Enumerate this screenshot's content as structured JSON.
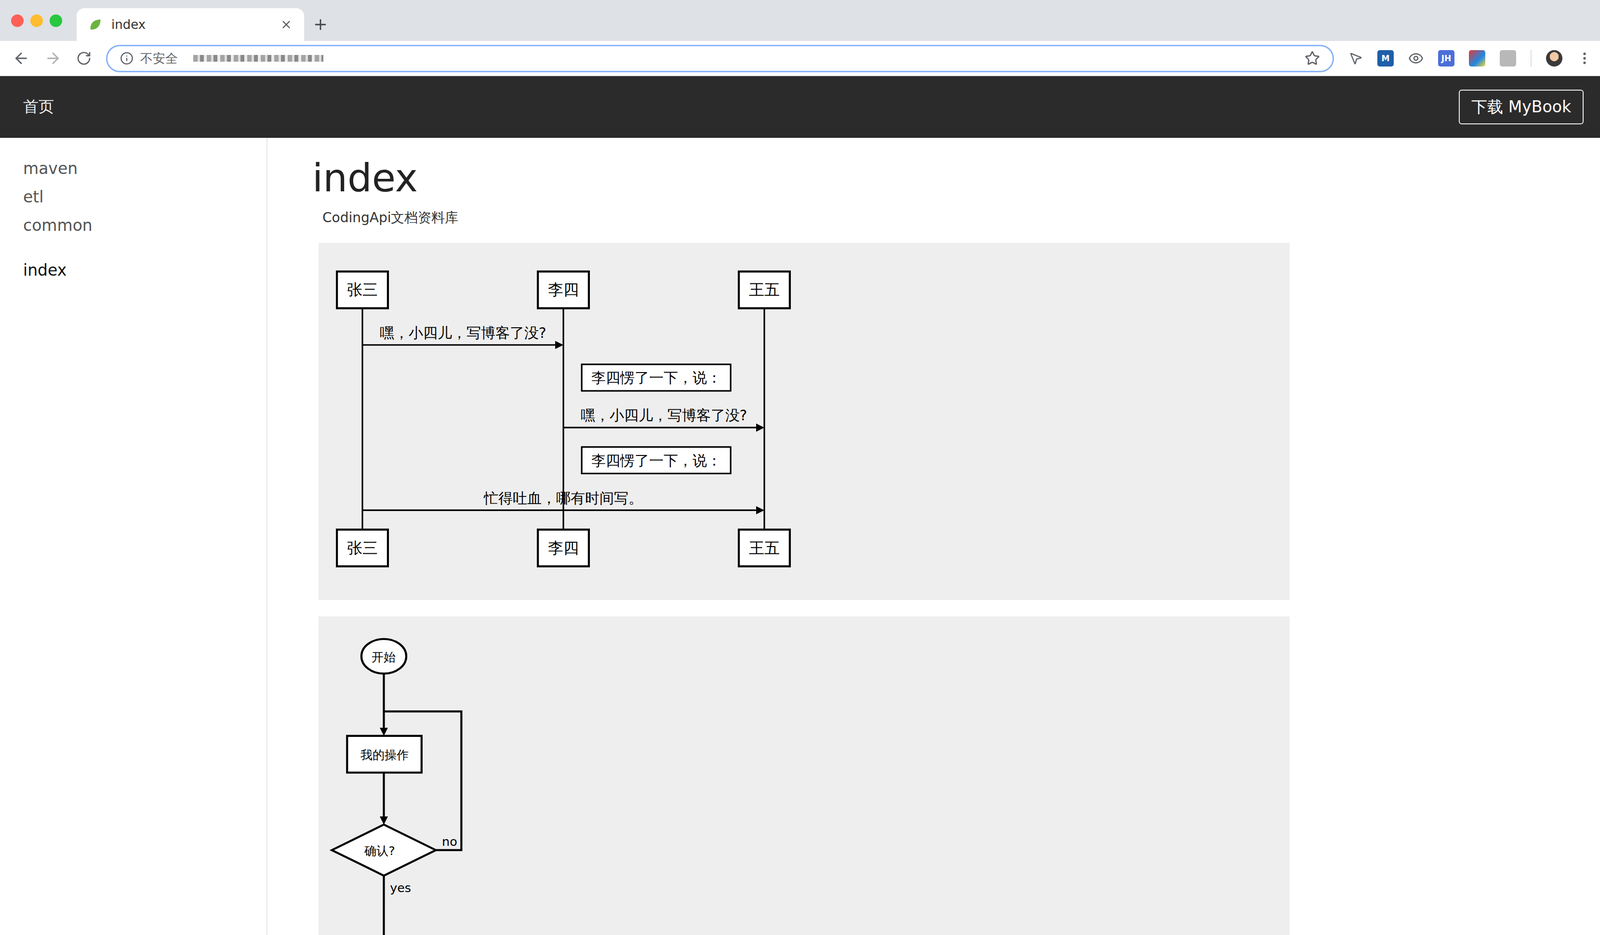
{
  "window": {
    "tab_title": "index",
    "security": "不安全",
    "extensions": [
      {
        "label": "M",
        "color": "#1f5fa8"
      },
      {
        "label": "JH",
        "color": "#4b6fd8"
      }
    ]
  },
  "navbar": {
    "home": "首页",
    "download": "下载 MyBook"
  },
  "sidebar": {
    "groups": [
      {
        "items": [
          {
            "label": "maven",
            "selected": false
          },
          {
            "label": "etl",
            "selected": false
          },
          {
            "label": "common",
            "selected": false
          }
        ]
      },
      {
        "items": [
          {
            "label": "index",
            "selected": true
          }
        ]
      }
    ]
  },
  "page": {
    "title": "index",
    "subtitle": "CodingApi文档资料库"
  },
  "sequence": {
    "actors": [
      "张三",
      "李四",
      "王五"
    ],
    "steps": [
      {
        "kind": "message",
        "from": 0,
        "to": 1,
        "text": "嘿，小四儿，写博客了没?"
      },
      {
        "kind": "note",
        "over": 1,
        "text": "李四愣了一下，说："
      },
      {
        "kind": "message",
        "from": 1,
        "to": 2,
        "text": "嘿，小四儿，写博客了没?"
      },
      {
        "kind": "note",
        "over": 1,
        "text": "李四愣了一下，说："
      },
      {
        "kind": "message",
        "from": 0,
        "to": 2,
        "text": "忙得吐血，哪有时间写。"
      }
    ]
  },
  "flowchart": {
    "nodes": [
      {
        "kind": "start",
        "text": "开始"
      },
      {
        "kind": "operation",
        "text": "我的操作"
      },
      {
        "kind": "condition",
        "text": "确认?"
      }
    ],
    "branches": {
      "no": "no",
      "yes": "yes"
    }
  }
}
